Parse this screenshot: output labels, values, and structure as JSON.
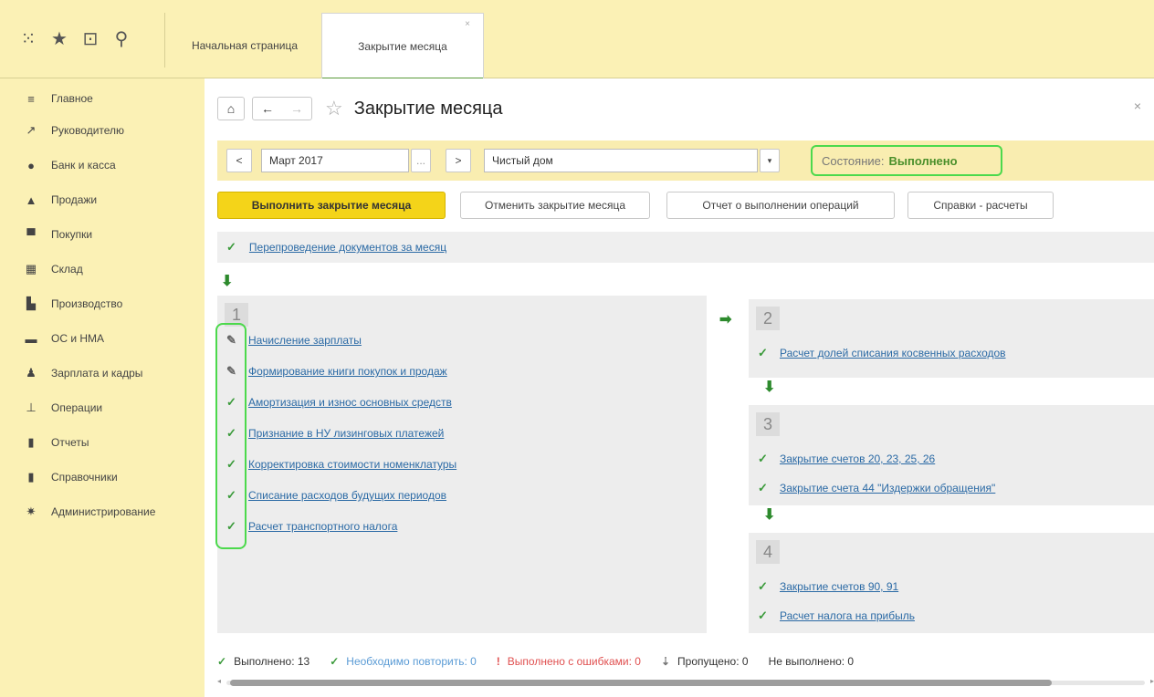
{
  "topbar": {
    "icons": [
      "apps-grid-icon",
      "star-icon",
      "history-icon",
      "search-icon"
    ],
    "tabs": [
      {
        "label": "Начальная страница"
      },
      {
        "label": "Закрытие месяца",
        "close": "×"
      }
    ]
  },
  "sidebar": {
    "items": [
      {
        "label": "Главное",
        "icon": "menu-icon",
        "glyph": "≡"
      },
      {
        "label": "Руководителю",
        "icon": "trend-icon",
        "glyph": "↗"
      },
      {
        "label": "Банк и касса",
        "icon": "coin-icon",
        "glyph": "●"
      },
      {
        "label": "Продажи",
        "icon": "bag-icon",
        "glyph": "▲"
      },
      {
        "label": "Покупки",
        "icon": "cart-icon",
        "glyph": "▀"
      },
      {
        "label": "Склад",
        "icon": "warehouse-icon",
        "glyph": "▦"
      },
      {
        "label": "Производство",
        "icon": "factory-icon",
        "glyph": "▙"
      },
      {
        "label": "ОС и НМА",
        "icon": "truck-icon",
        "glyph": "▬"
      },
      {
        "label": "Зарплата и кадры",
        "icon": "person-icon",
        "glyph": "♟"
      },
      {
        "label": "Операции",
        "icon": "operations-icon",
        "glyph": "⊥"
      },
      {
        "label": "Отчеты",
        "icon": "bar-chart-icon",
        "glyph": "▮"
      },
      {
        "label": "Справочники",
        "icon": "book-icon",
        "glyph": "▮"
      },
      {
        "label": "Администрирование",
        "icon": "gear-icon",
        "glyph": "✷"
      }
    ]
  },
  "header": {
    "title": "Закрытие месяца",
    "close": "×"
  },
  "period": {
    "prev": "<",
    "month": "Март 2017",
    "ellipsis": "...",
    "next": ">",
    "org": "Чистый дом",
    "state_label": "Состояние:",
    "state_value": "Выполнено"
  },
  "actions": {
    "run": "Выполнить закрытие месяца",
    "cancel": "Отменить закрытие месяца",
    "report": "Отчет о выполнении операций",
    "calc": "Справки - расчеты"
  },
  "redo": "Перепроведение документов за месяц",
  "blocks": [
    {
      "num": "1",
      "ops": [
        {
          "label": "Начисление зарплаты",
          "mark": "pencil"
        },
        {
          "label": "Формирование книги покупок и продаж",
          "mark": "pencil"
        },
        {
          "label": "Амортизация и износ основных средств",
          "mark": "check"
        },
        {
          "label": "Признание в НУ лизинговых платежей",
          "mark": "check"
        },
        {
          "label": "Корректировка стоимости номенклатуры",
          "mark": "check"
        },
        {
          "label": "Списание расходов будущих периодов",
          "mark": "check"
        },
        {
          "label": "Расчет транспортного налога",
          "mark": "check"
        }
      ]
    },
    {
      "num": "2",
      "ops": [
        {
          "label": "Расчет долей списания косвенных расходов",
          "mark": "check"
        }
      ]
    },
    {
      "num": "3",
      "ops": [
        {
          "label": "Закрытие счетов 20, 23, 25, 26",
          "mark": "check"
        },
        {
          "label": "Закрытие счета 44 \"Издержки обращения\"",
          "mark": "check"
        }
      ]
    },
    {
      "num": "4",
      "ops": [
        {
          "label": "Закрытие счетов 90, 91",
          "mark": "check"
        },
        {
          "label": "Расчет налога на прибыль",
          "mark": "check"
        }
      ]
    }
  ],
  "status": {
    "done": "Выполнено: 13",
    "repeat": "Необходимо повторить: 0",
    "errors": "Выполнено с ошибками: 0",
    "skipped": "Пропущено: 0",
    "not_done": "Не выполнено: 0"
  },
  "colors": {
    "accent_yellow": "#f4d419",
    "panel_yellow": "#fbf1b5",
    "success_green": "#3a9a3a",
    "highlight_green": "#4cd94c",
    "link_blue": "#2b6aa5",
    "error_red": "#e05050"
  }
}
